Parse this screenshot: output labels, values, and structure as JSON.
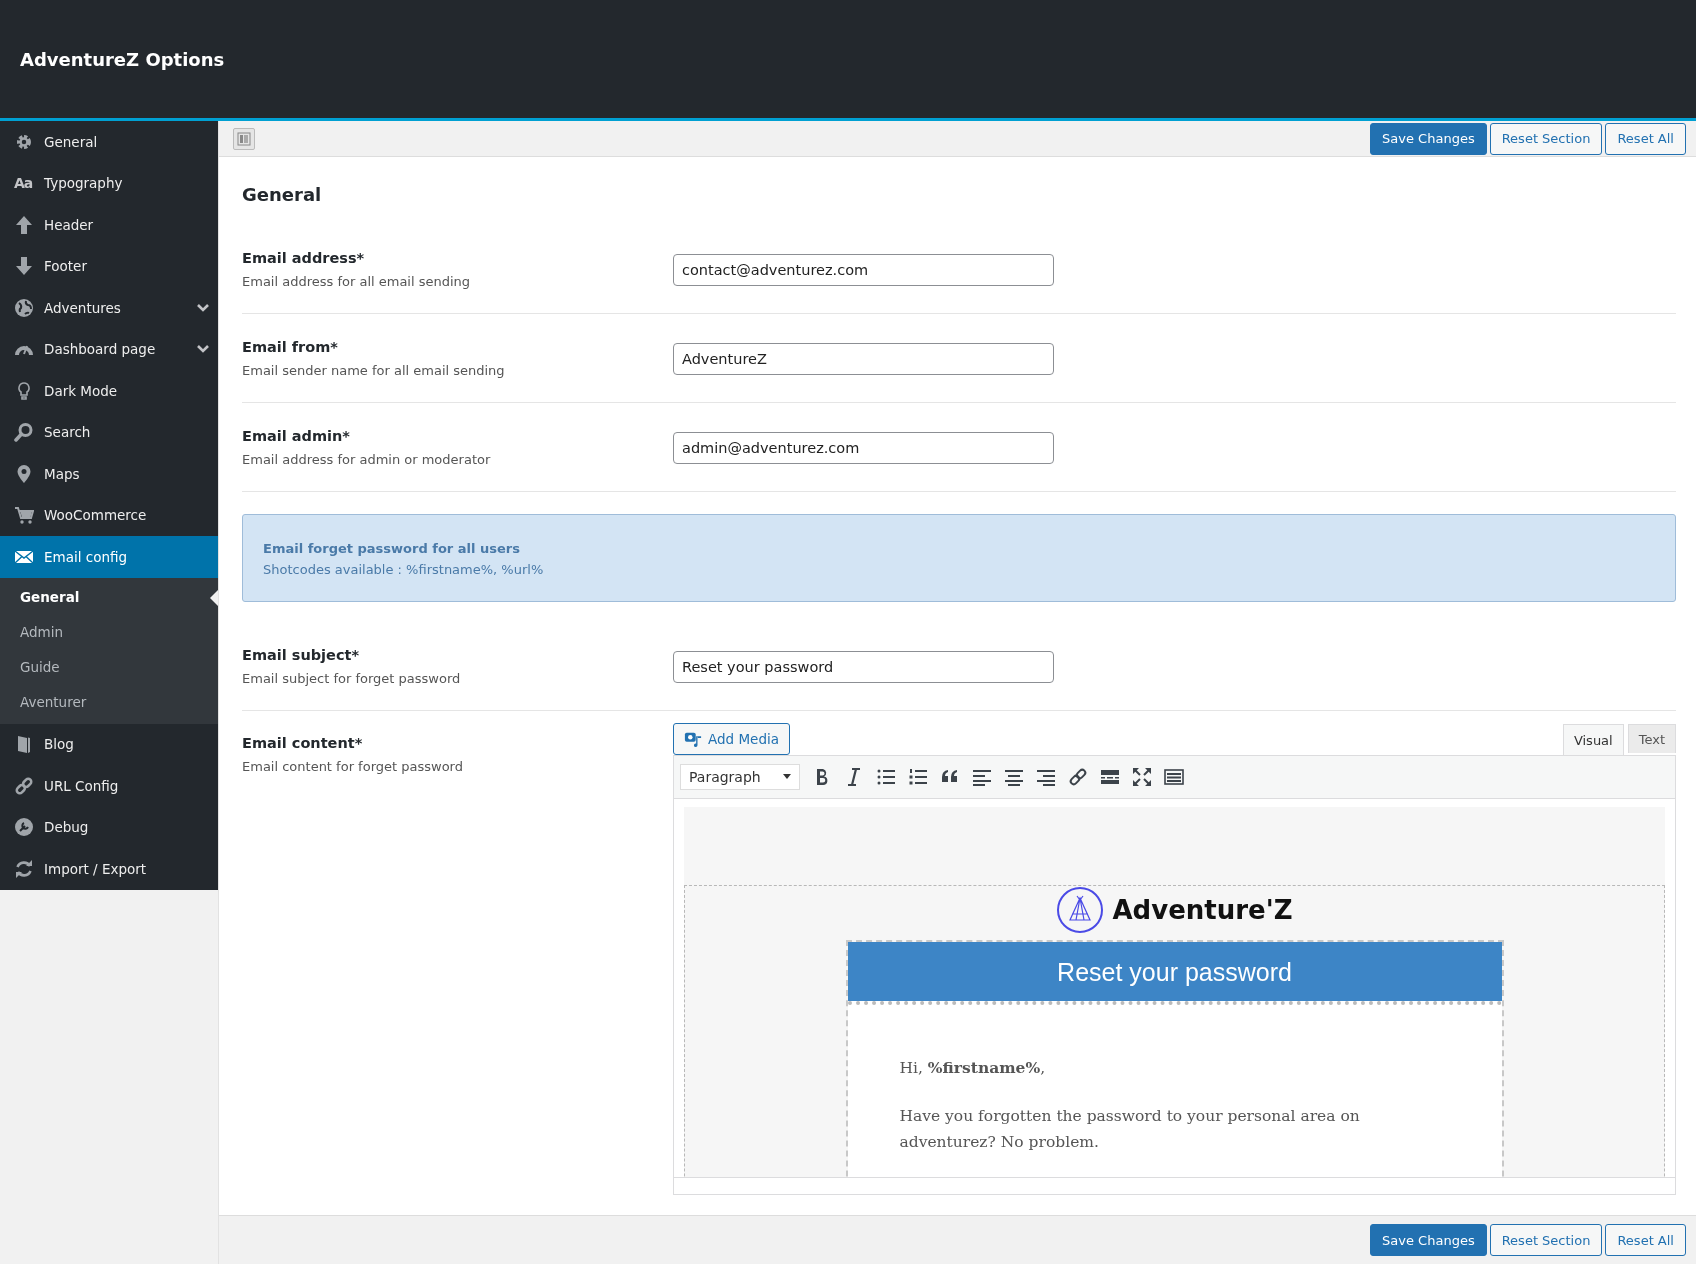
{
  "header": {
    "title": "AdventureZ Options"
  },
  "sidebar": {
    "items": [
      {
        "label": "General",
        "kind": "plain",
        "selected": false
      },
      {
        "label": "Typography",
        "kind": "plain",
        "selected": false,
        "icon_text": "Aa"
      },
      {
        "label": "Header",
        "kind": "plain",
        "selected": false
      },
      {
        "label": "Footer",
        "kind": "plain",
        "selected": false
      },
      {
        "label": "Adventures",
        "kind": "collapsed",
        "selected": false
      },
      {
        "label": "Dashboard page",
        "kind": "collapsed",
        "selected": false
      },
      {
        "label": "Dark Mode",
        "kind": "plain",
        "selected": false
      },
      {
        "label": "Search",
        "kind": "plain",
        "selected": false
      },
      {
        "label": "Maps",
        "kind": "plain",
        "selected": false
      },
      {
        "label": "WooCommerce",
        "kind": "plain",
        "selected": false
      },
      {
        "label": "Email config",
        "kind": "expanded",
        "selected": true,
        "children": [
          {
            "label": "General",
            "selected": true
          },
          {
            "label": "Admin",
            "selected": false
          },
          {
            "label": "Guide",
            "selected": false
          },
          {
            "label": "Aventurer",
            "selected": false
          }
        ]
      },
      {
        "label": "Blog",
        "kind": "plain",
        "selected": false
      },
      {
        "label": "URL Config",
        "kind": "plain",
        "selected": false
      },
      {
        "label": "Debug",
        "kind": "plain",
        "selected": false
      },
      {
        "label": "Import / Export",
        "kind": "plain",
        "selected": false
      }
    ]
  },
  "actions": [
    "Save Changes",
    "Reset Section",
    "Reset All"
  ],
  "section": {
    "title": "General"
  },
  "fields": [
    {
      "kind": "input",
      "label": "Email address*",
      "description": "Email address for all email sending",
      "value": "contact@adventurez.com"
    },
    {
      "kind": "input",
      "label": "Email from*",
      "description": "Email sender name for all email sending",
      "value": "AdventureZ"
    },
    {
      "kind": "input",
      "label": "Email admin*",
      "description": "Email address for admin or moderator",
      "value": "admin@adventurez.com"
    },
    {
      "kind": "info",
      "title": "Email forget password for all users",
      "text": "Shotcodes available : %firstname%, %url%"
    },
    {
      "kind": "input",
      "label": "Email subject*",
      "description": "Email subject for forget password",
      "value": "Reset your password"
    },
    {
      "kind": "editor",
      "label": "Email content*",
      "description": "Email content for forget password"
    }
  ],
  "editor": {
    "add_media": "Add Media",
    "tabs": [
      {
        "label": "Visual",
        "selected": true
      },
      {
        "label": "Text",
        "selected": false
      }
    ],
    "format": "Paragraph",
    "preview": {
      "logo_text": "Adventure'Z",
      "banner": "Reset your password",
      "greeting": "Hi, **%firstname%**,",
      "paragraph": "Have you forgotten the password to your personal area on adventurez? No problem."
    }
  },
  "footer_actions": [
    "Save Changes",
    "Reset Section",
    "Reset All"
  ]
}
